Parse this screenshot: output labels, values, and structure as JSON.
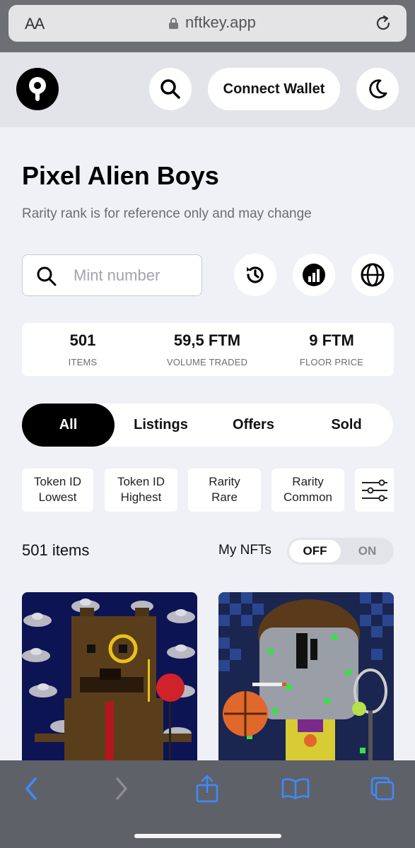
{
  "browser": {
    "text_size_label": "AA",
    "url": "nftkey.app"
  },
  "header": {
    "connect_wallet_label": "Connect Wallet"
  },
  "collection": {
    "title": "Pixel Alien Boys",
    "subtitle": "Rarity rank is for reference only and may change"
  },
  "search": {
    "placeholder": "Mint number"
  },
  "stats": [
    {
      "value": "501",
      "label": "ITEMS"
    },
    {
      "value": "59,5 FTM",
      "label": "VOLUME TRADED"
    },
    {
      "value": "9 FTM",
      "label": "FLOOR PRICE"
    }
  ],
  "tabs": [
    {
      "label": "All",
      "active": true
    },
    {
      "label": "Listings",
      "active": false
    },
    {
      "label": "Offers",
      "active": false
    },
    {
      "label": "Sold",
      "active": false
    }
  ],
  "sort_options": [
    {
      "line1": "Token ID",
      "line2": "Lowest"
    },
    {
      "line1": "Token ID",
      "line2": "Highest"
    },
    {
      "line1": "Rarity",
      "line2": "Rare"
    },
    {
      "line1": "Rarity",
      "line2": "Common"
    }
  ],
  "results": {
    "count_label": "501 items",
    "my_nfts_label": "My NFTs",
    "toggle_off": "OFF",
    "toggle_on": "ON",
    "my_nfts_state": "OFF"
  },
  "icons": {
    "logo": "nftkey-keyhole-logo",
    "search": "search-icon",
    "theme": "moon-icon",
    "history": "history-icon",
    "stats": "chart-icon",
    "website": "globe-icon",
    "filters": "sliders-icon"
  },
  "nft_cards": [
    {
      "name": "bear-monocle-alien-nft"
    },
    {
      "name": "grey-alien-basketball-nft"
    }
  ],
  "colors": {
    "accent": "#000000",
    "page_background": "#f0f1f7",
    "header_background": "#e2e4ea",
    "safari_chrome": "#5f6169",
    "safari_blue": "#3d8bff"
  }
}
